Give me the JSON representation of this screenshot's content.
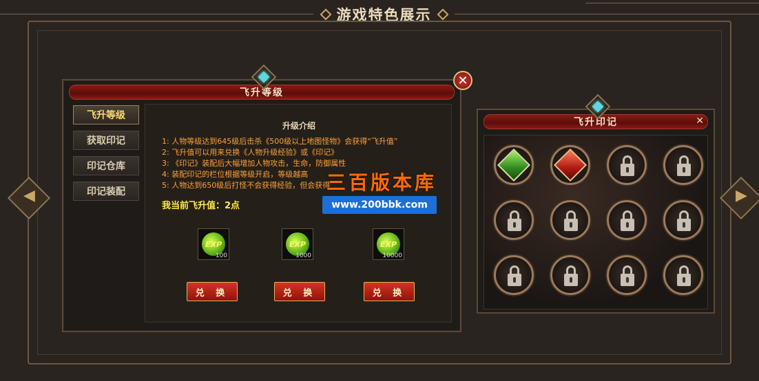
{
  "page": {
    "section_title": "游戏特色展示"
  },
  "main_panel": {
    "title": "飞升等级",
    "close_label": "✕",
    "tabs": [
      {
        "label": "飞升等级",
        "active": true
      },
      {
        "label": "获取印记",
        "active": false
      },
      {
        "label": "印记仓库",
        "active": false
      },
      {
        "label": "印记装配",
        "active": false
      }
    ],
    "intro_title": "升级介绍",
    "intro_lines": [
      "1: 人物等级达到645级后击杀《500级以上地图怪物》会获得“飞升值”",
      "2: 飞升值可以用来兑换《人物升级经验》或《印记》",
      "3: 《印记》装配后大幅增加人物攻击，生命，防御属性",
      "4: 装配印记的栏位根据等级开启，等级越高",
      "5: 人物达到650级后打怪不会获得经验，但会获得"
    ],
    "current_value": "我当前飞升值：2点",
    "exp_items": [
      {
        "label": "EXP",
        "count": "100"
      },
      {
        "label": "EXP",
        "count": "1000"
      },
      {
        "label": "EXP",
        "count": "10000"
      }
    ],
    "exchange_label": "兑 换"
  },
  "watermark": {
    "brand": "三百版本库",
    "url": "www.200bbk.com"
  },
  "seal_panel": {
    "title": "飞升印记",
    "close_label": "✕",
    "slots": [
      {
        "state": "gem-green"
      },
      {
        "state": "gem-red"
      },
      {
        "state": "locked"
      },
      {
        "state": "locked"
      },
      {
        "state": "locked"
      },
      {
        "state": "locked"
      },
      {
        "state": "locked"
      },
      {
        "state": "locked"
      },
      {
        "state": "locked"
      },
      {
        "state": "locked"
      },
      {
        "state": "locked"
      },
      {
        "state": "locked"
      }
    ]
  },
  "colors": {
    "accent_gold": "#c9a865",
    "header_red": "#8a1a14",
    "intro_orange": "#ff9f3a",
    "value_yellow": "#ffe84a"
  }
}
